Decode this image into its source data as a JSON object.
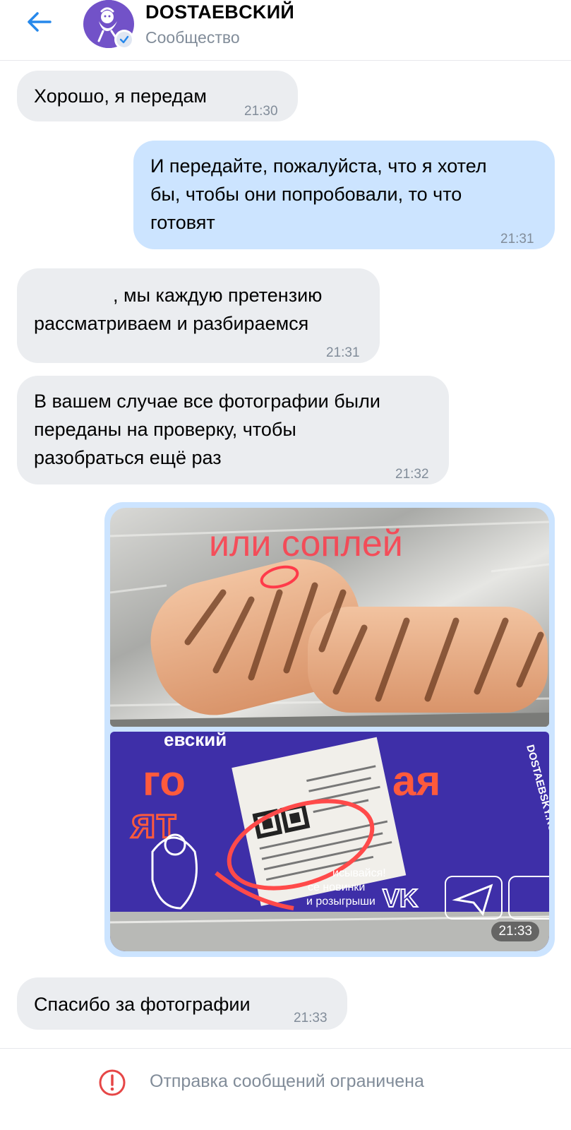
{
  "header": {
    "back_icon": "arrow-left-icon",
    "title": "DOSTAEBCKИЙ",
    "subtitle": "Сообщество",
    "verified_icon": "check-icon"
  },
  "messages": [
    {
      "direction": "in",
      "text": "Хорошо, я передам",
      "time": "21:30"
    },
    {
      "direction": "out",
      "lines": [
        "И передайте, пожалуйста, что я хотел",
        "бы, чтобы они попробовали, то что",
        "готовят"
      ],
      "time": "21:31"
    },
    {
      "direction": "in",
      "lines": [
        ", мы каждую претензию",
        "рассматриваем и разбираемся"
      ],
      "time": "21:31"
    },
    {
      "direction": "in",
      "lines": [
        "В вашем случае все фотографии были",
        "переданы на проверку, чтобы",
        "разобраться ещё раз"
      ],
      "time": "21:32"
    },
    {
      "direction": "out",
      "type": "photos",
      "photo1_caption": "или соплей",
      "photo2_texts": {
        "brand": "евский",
        "headline1": "го",
        "headline2": "ят",
        "headline_tail": "ая",
        "url": "DOSTAEBSKY.RU",
        "subscribe": "исывайся!",
        "news": "се новинки",
        "draws": "и розыгрыши",
        "vk": "VK"
      },
      "time": "21:33"
    },
    {
      "direction": "in",
      "text": "Спасибо за фотографии",
      "time": "21:33"
    }
  ],
  "footer": {
    "icon": "alert-circle-icon",
    "text": "Отправка сообщений ограничена"
  },
  "colors": {
    "accent": "#2688eb",
    "incoming_bubble": "#ebedf0",
    "outgoing_bubble": "#cce4ff",
    "secondary_text": "#818c99",
    "alert": "#e64646"
  }
}
